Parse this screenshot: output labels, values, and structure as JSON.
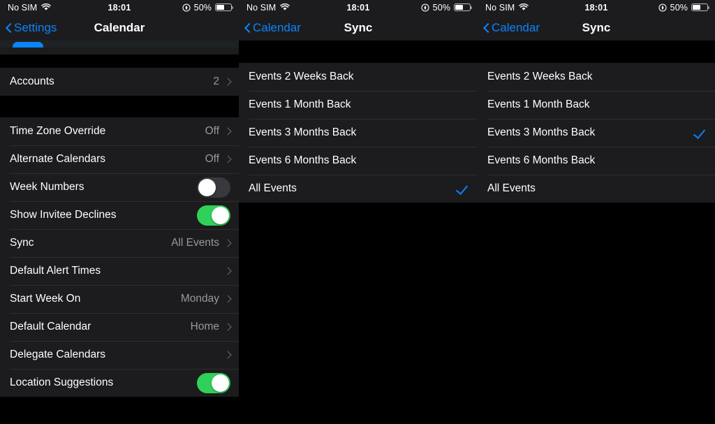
{
  "panels": [
    {
      "status": {
        "carrier": "No SIM",
        "time": "18:01",
        "battery": "50%",
        "wifi_icon": "wifi-icon",
        "location_icon": "location-services-icon",
        "battery_icon": "battery-icon"
      },
      "nav": {
        "back_label": "Settings",
        "title": "Calendar",
        "back_icon": "chevron-left-icon"
      },
      "groups": [
        {
          "rows": [
            {
              "label": "Accounts",
              "value": "2",
              "accessory": "chevron"
            }
          ]
        },
        {
          "rows": [
            {
              "label": "Time Zone Override",
              "value": "Off",
              "accessory": "chevron"
            },
            {
              "label": "Alternate Calendars",
              "value": "Off",
              "accessory": "chevron"
            },
            {
              "label": "Week Numbers",
              "value": "",
              "accessory": "toggle-off"
            },
            {
              "label": "Show Invitee Declines",
              "value": "",
              "accessory": "toggle-on"
            },
            {
              "label": "Sync",
              "value": "All Events",
              "accessory": "chevron"
            },
            {
              "label": "Default Alert Times",
              "value": "",
              "accessory": "chevron"
            },
            {
              "label": "Start Week On",
              "value": "Monday",
              "accessory": "chevron"
            },
            {
              "label": "Default Calendar",
              "value": "Home",
              "accessory": "chevron"
            },
            {
              "label": "Delegate Calendars",
              "value": "",
              "accessory": "chevron"
            },
            {
              "label": "Location Suggestions",
              "value": "",
              "accessory": "toggle-on"
            }
          ]
        }
      ]
    },
    {
      "status": {
        "carrier": "No SIM",
        "time": "18:01",
        "battery": "50%",
        "wifi_icon": "wifi-icon",
        "location_icon": "location-services-icon",
        "battery_icon": "battery-icon"
      },
      "nav": {
        "back_label": "Calendar",
        "title": "Sync",
        "back_icon": "chevron-left-icon"
      },
      "options": [
        {
          "label": "Events 2 Weeks Back",
          "selected": false
        },
        {
          "label": "Events 1 Month Back",
          "selected": false
        },
        {
          "label": "Events 3 Months Back",
          "selected": false
        },
        {
          "label": "Events 6 Months Back",
          "selected": false
        },
        {
          "label": "All Events",
          "selected": true
        }
      ]
    },
    {
      "status": {
        "carrier": "No SIM",
        "time": "18:01",
        "battery": "50%",
        "wifi_icon": "wifi-icon",
        "location_icon": "location-services-icon",
        "battery_icon": "battery-icon"
      },
      "nav": {
        "back_label": "Calendar",
        "title": "Sync",
        "back_icon": "chevron-left-icon"
      },
      "options": [
        {
          "label": "Events 2 Weeks Back",
          "selected": false
        },
        {
          "label": "Events 1 Month Back",
          "selected": false
        },
        {
          "label": "Events 3 Months Back",
          "selected": true
        },
        {
          "label": "Events 6 Months Back",
          "selected": false
        },
        {
          "label": "All Events",
          "selected": false
        }
      ]
    }
  ],
  "colors": {
    "accent_blue": "#0a84ff",
    "toggle_on_green": "#30d158",
    "toggle_off_gray": "#39393d",
    "row_bg": "#1c1c1e",
    "page_bg": "#000000",
    "secondary_text": "#98989d"
  }
}
